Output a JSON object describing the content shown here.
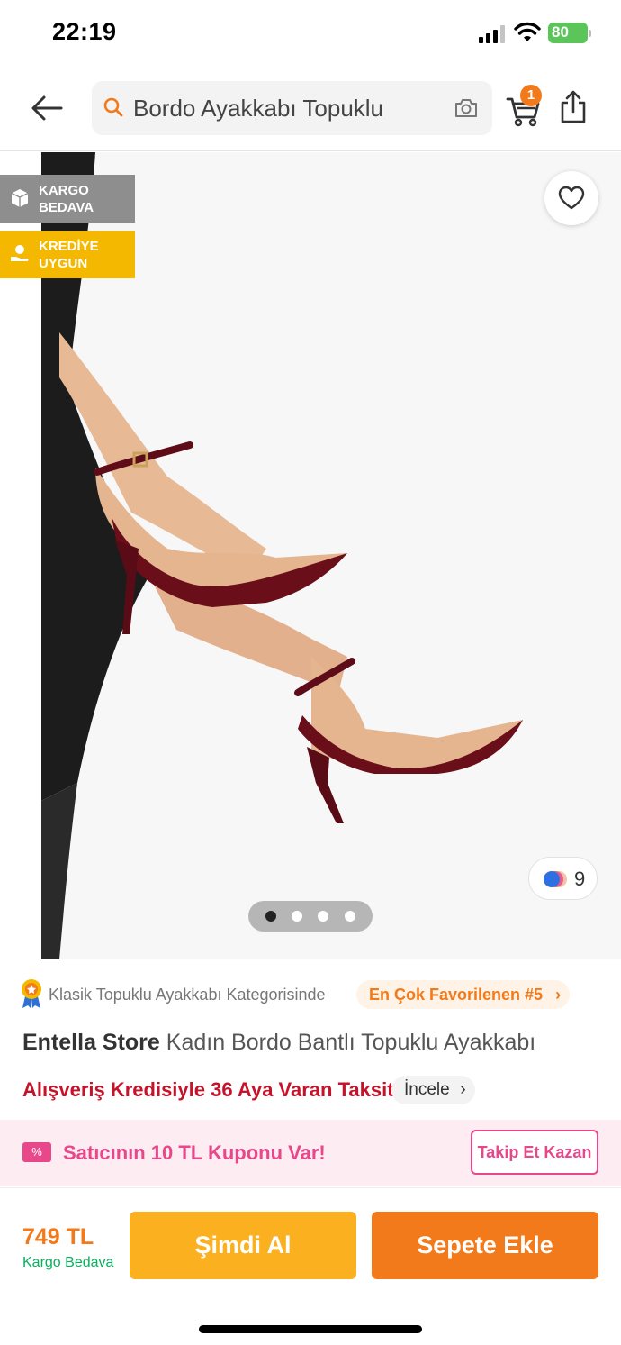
{
  "status_bar": {
    "time": "22:19",
    "battery": "80"
  },
  "header": {
    "search_text": "Bordo Ayakkabı Topuklu",
    "cart_count": "1"
  },
  "gallery": {
    "badges": [
      {
        "line1": "KARGO",
        "line2": "BEDAVA",
        "color": "#8e8e8e"
      },
      {
        "line1": "KREDİYE",
        "line2": "UYGUN",
        "color": "#f5b800"
      }
    ],
    "color_count": "9",
    "page_index": 1,
    "page_total": 4
  },
  "product": {
    "rank_category": "Klasik Topuklu Ayakkabı Kategorisinde",
    "rank_label": "En Çok Favorilenen #5",
    "brand": "Entella Store",
    "name": "Kadın Bordo Bantlı Topuklu Ayakkabı",
    "credit_text": "Alışveriş Kredisiyle 36 Aya Varan Taksit!",
    "credit_link": "İncele"
  },
  "coupon": {
    "icon_glyph": "%",
    "text": "Satıcının 10 TL Kuponu Var!",
    "button": "Takip Et Kazan"
  },
  "bottom": {
    "price": "749 TL",
    "shipping": "Kargo Bedava",
    "buy_now": "Şimdi Al",
    "add_to_cart": "Sepete Ekle"
  },
  "colors": {
    "accent": "#f27a1a",
    "buy_now": "#fbb020",
    "coupon": "#e8488a",
    "credit": "#c4132a",
    "shipping": "#0bb05c"
  }
}
